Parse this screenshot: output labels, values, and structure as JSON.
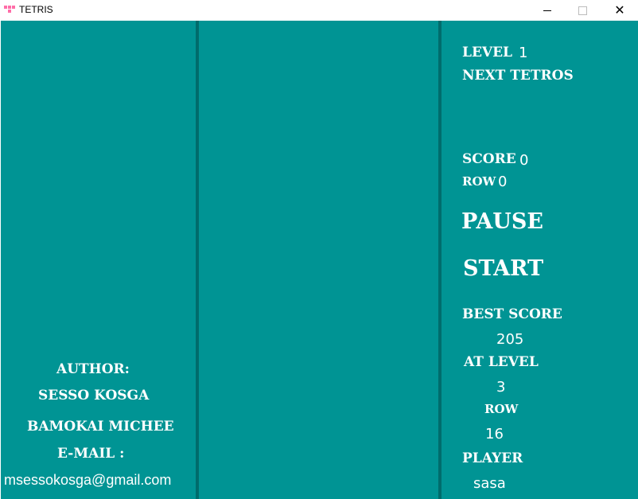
{
  "window": {
    "title": "TETRIS",
    "close_glyph": "✕"
  },
  "author_panel": {
    "author_label": "AUTHOR:",
    "name_line1": "SESSO KOSGA",
    "name_line2": "BAMOKAI MICHEE",
    "email_label": "E-MAIL :",
    "email": "msessokosga@gmail.com"
  },
  "stats": {
    "level_label": "LEVEL",
    "level_value": "1",
    "next_label": "NEXT TETROS",
    "score_label": "SCORE",
    "score_value": "0",
    "row_label": "ROW",
    "row_value": "0",
    "pause_label": "PAUSE",
    "start_label": "START",
    "best_score_label": "BEST SCORE",
    "best_score_value": "205",
    "at_level_label": "AT LEVEL",
    "at_level_value": "3",
    "best_row_label": "ROW",
    "best_row_value": "16",
    "player_label": "PLAYER",
    "player_value": "sasa"
  },
  "colors": {
    "background": "#009494",
    "divider": "#006c6c",
    "text": "#ffffff"
  }
}
